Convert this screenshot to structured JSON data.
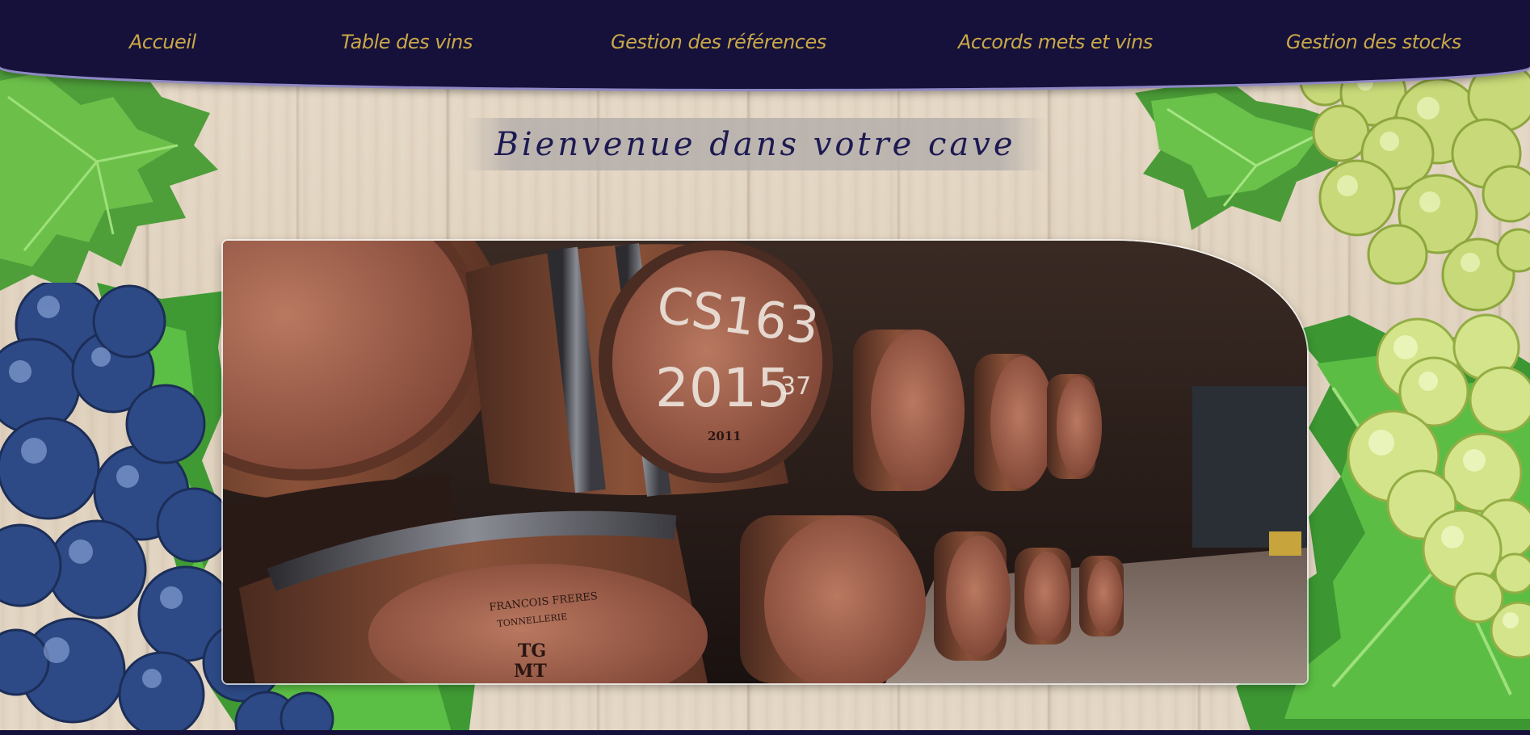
{
  "nav": {
    "items": [
      {
        "label": "Accueil"
      },
      {
        "label": "Table des vins"
      },
      {
        "label": "Gestion des références"
      },
      {
        "label": "Accords mets et vins"
      },
      {
        "label": "Gestion des stocks"
      }
    ]
  },
  "page": {
    "title": "Bienvenue dans votre cave"
  },
  "hero": {
    "barrel_marks": [
      "CS163",
      "2015",
      "37",
      "2011",
      "FRANCOIS FRERES",
      "TONNELLERIE",
      "TG",
      "MT"
    ]
  },
  "colors": {
    "nav_bg": "#15113a",
    "nav_text": "#c9a848",
    "title_text": "#1d1a52"
  }
}
